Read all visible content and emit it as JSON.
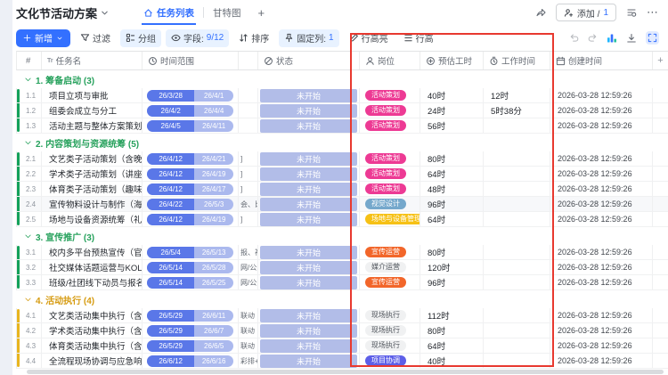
{
  "titlebar": {
    "title": "文化节活动方案",
    "tabs": [
      {
        "label": "任务列表",
        "active": true
      },
      {
        "label": "甘特图",
        "active": false
      }
    ],
    "add_view": "+",
    "add_member_label": "添加 /",
    "add_member_count": "1"
  },
  "toolbar": {
    "new_label": "新增",
    "filter_label": "过滤",
    "group_label": "分组",
    "fields_label": "字段:",
    "fields_count": "9/12",
    "sort_label": "排序",
    "pin_label": "固定列:",
    "pin_count": "1",
    "highlight_label": "行高亮",
    "rowheight_label": "行高"
  },
  "table": {
    "headers": {
      "num": "#",
      "task": "任务名",
      "range": "时间范围",
      "extra": "",
      "status": "状态",
      "role": "岗位",
      "est": "预估工时",
      "work": "工作时间",
      "created": "创建时间",
      "plus": "+"
    }
  },
  "colors": {
    "primary": "#3370ff",
    "chip_bg": "#e8f2ff",
    "red_box": "#e8392f",
    "date_dark": "#5a77e8",
    "date_light": "#abb9ee",
    "status_pill": "#b2bde8",
    "group_green_text": "#26a15c",
    "group_green_bar": "#14a15a",
    "group_amber_text": "#d69b10",
    "group_amber_bar": "#e8b51f"
  },
  "tag_colors": {
    "pink": "#ed3a94",
    "steel": "#75a8cc",
    "yellow": "#f6c116",
    "orange": "#f2662a",
    "purple": "#5d5fe8",
    "gray": "#f0f1f2"
  },
  "icons": {
    "chevron-down": "⌄",
    "home": "house",
    "share": "promote-arrow",
    "person-add": "user-plus",
    "list-settings": "list",
    "more": "⋯",
    "plus": "+",
    "filter": "funnel",
    "group": "layers",
    "fields": "eye",
    "sort": "arrows-up-down",
    "pin": "pushpin",
    "highlight": "pencil",
    "row-height": "lines",
    "undo": "arrow-undo",
    "redo": "arrow-redo",
    "chart": "bar-chart",
    "download": "arrow-to-line",
    "expand": "corners-out",
    "text-field": "Tr",
    "clock": "clock",
    "status": "circle-slash",
    "person": "user",
    "estimate": "circle-plus",
    "timer": "stopwatch",
    "calendar": "calendar"
  },
  "groups": [
    {
      "label": "1. 筹备启动",
      "count": "(3)",
      "color": "green",
      "rows": [
        {
          "num": "1.1",
          "task": "项目立项与审批",
          "start": "26/3/28",
          "end": "26/4/1",
          "extra": "",
          "status": "未开始",
          "role": "活动策划",
          "role_color": "pink",
          "est": "40时",
          "work": "12时",
          "created": "2026-03-28 12:59:26"
        },
        {
          "num": "1.2",
          "task": "组委会成立与分工",
          "start": "26/4/2",
          "end": "26/4/4",
          "extra": "",
          "status": "未开始",
          "role": "活动策划",
          "role_color": "pink",
          "est": "24时",
          "work": "5时38分",
          "created": "2026-03-28 12:59:26"
        },
        {
          "num": "1.3",
          "task": "活动主题与整体方案策划",
          "start": "26/4/5",
          "end": "26/4/11",
          "extra": "",
          "status": "未开始",
          "role": "活动策划",
          "role_color": "pink",
          "est": "56时",
          "work": "",
          "created": "2026-03-28 12:59:26"
        }
      ]
    },
    {
      "label": "2. 内容策划与资源统筹",
      "count": "(5)",
      "color": "green",
      "rows": [
        {
          "num": "2.1",
          "task": "文艺类子活动策划（含晚...",
          "start": "26/4/12",
          "end": "26/4/21",
          "extra": "]",
          "status": "未开始",
          "role": "活动策划",
          "role_color": "pink",
          "est": "80时",
          "work": "",
          "created": "2026-03-28 12:59:26"
        },
        {
          "num": "2.2",
          "task": "学术类子活动策划（讲座...",
          "start": "26/4/12",
          "end": "26/4/19",
          "extra": "]",
          "status": "未开始",
          "role": "活动策划",
          "role_color": "pink",
          "est": "64时",
          "work": "",
          "created": "2026-03-28 12:59:26"
        },
        {
          "num": "2.3",
          "task": "体育类子活动策划（趣味...",
          "start": "26/4/12",
          "end": "26/4/17",
          "extra": "]",
          "status": "未开始",
          "role": "活动策划",
          "role_color": "pink",
          "est": "48时",
          "work": "",
          "created": "2026-03-28 12:59:26"
        },
        {
          "num": "2.4",
          "task": "宣传物料设计与制作（海...",
          "start": "26/4/22",
          "end": "26/5/3",
          "extra": "会、比",
          "status": "未开始",
          "role": "视觉设计",
          "role_color": "steel",
          "est": "96时",
          "work": "",
          "created": "2026-03-28 12:59:26",
          "highlight": true
        },
        {
          "num": "2.5",
          "task": "场地与设备资源统筹（礼...",
          "start": "26/4/12",
          "end": "26/4/19",
          "extra": "]",
          "status": "未开始",
          "role": "场地与设备管理",
          "role_color": "yellow",
          "est": "64时",
          "work": "",
          "created": "2026-03-28 12:59:26"
        }
      ]
    },
    {
      "label": "3. 宣传推广",
      "count": "(3)",
      "color": "green",
      "rows": [
        {
          "num": "3.1",
          "task": "校内多平台预热宣传（官...",
          "start": "26/5/4",
          "end": "26/5/13",
          "extra": "报、视",
          "status": "未开始",
          "role": "宣传运营",
          "role_color": "orange",
          "est": "80时",
          "work": "",
          "created": "2026-03-28 12:59:26"
        },
        {
          "num": "3.2",
          "task": "社交媒体话题运营与KOL...",
          "start": "26/5/14",
          "end": "26/5/28",
          "extra": "网/公众",
          "status": "未开始",
          "role": "媒介运营",
          "role_color": "gray",
          "est": "120时",
          "work": "",
          "created": "2026-03-28 12:59:26"
        },
        {
          "num": "3.3",
          "task": "班级/社团线下动员与报名...",
          "start": "26/5/14",
          "end": "26/5/25",
          "extra": "网/公众",
          "status": "未开始",
          "role": "宣传运营",
          "role_color": "orange",
          "est": "96时",
          "work": "",
          "created": "2026-03-28 12:59:26"
        }
      ]
    },
    {
      "label": "4. 活动执行",
      "count": "(4)",
      "color": "amber",
      "rows": [
        {
          "num": "4.1",
          "task": "文艺类活动集中执行（含...",
          "start": "26/5/29",
          "end": "26/6/11",
          "extra": "联动",
          "status": "未开始",
          "role": "现场执行",
          "role_color": "gray",
          "est": "112时",
          "work": "",
          "created": "2026-03-28 12:59:26"
        },
        {
          "num": "4.2",
          "task": "学术类活动集中执行（含...",
          "start": "26/5/29",
          "end": "26/6/7",
          "extra": "联动",
          "status": "未开始",
          "role": "现场执行",
          "role_color": "gray",
          "est": "80时",
          "work": "",
          "created": "2026-03-28 12:59:26"
        },
        {
          "num": "4.3",
          "task": "体育类活动集中执行（含...",
          "start": "26/5/29",
          "end": "26/6/5",
          "extra": "联动",
          "status": "未开始",
          "role": "现场执行",
          "role_color": "gray",
          "est": "64时",
          "work": "",
          "created": "2026-03-28 12:59:26"
        },
        {
          "num": "4.4",
          "task": "全流程现场协调与应急响应",
          "start": "26/6/12",
          "end": "26/6/16",
          "extra": "彩排+",
          "status": "未开始",
          "role": "项目协调",
          "role_color": "purple",
          "est": "40时",
          "work": "",
          "created": "2026-03-28 12:59:26"
        }
      ]
    }
  ]
}
